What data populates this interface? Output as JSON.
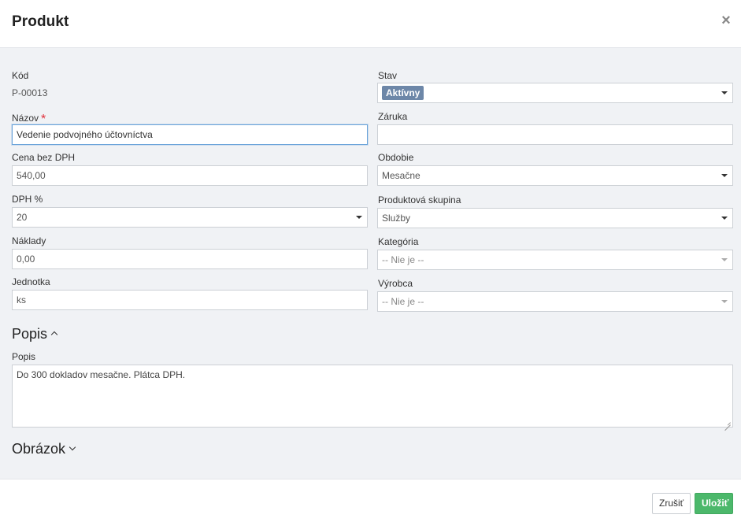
{
  "dialog": {
    "title": "Produkt",
    "close_symbol": "×"
  },
  "form": {
    "kod": {
      "label": "Kód",
      "value": "P-00013"
    },
    "nazov": {
      "label": "Názov",
      "required_mark": "*",
      "value": "Vedenie podvojného účtovníctva"
    },
    "cena": {
      "label": "Cena bez DPH",
      "value": "540,00"
    },
    "dph": {
      "label": "DPH %",
      "value": "20"
    },
    "naklady": {
      "label": "Náklady",
      "value": "0,00"
    },
    "jednotka": {
      "label": "Jednotka",
      "value": "ks"
    },
    "stav": {
      "label": "Stav",
      "value": "Aktívny"
    },
    "zaruka": {
      "label": "Záruka",
      "value": ""
    },
    "obdobie": {
      "label": "Obdobie",
      "value": "Mesačne"
    },
    "skupina": {
      "label": "Produktová skupina",
      "value": "Služby"
    },
    "kategoria": {
      "label": "Kategória",
      "value": "-- Nie je --"
    },
    "vyrobca": {
      "label": "Výrobca",
      "value": "-- Nie je --"
    }
  },
  "sections": {
    "popis": {
      "title": "Popis",
      "expanded": true,
      "field_label": "Popis",
      "value": "Do 300 dokladov mesačne. Plátca DPH."
    },
    "obrazok": {
      "title": "Obrázok",
      "expanded": false
    }
  },
  "footer": {
    "cancel_label": "Zrušiť",
    "save_label": "Uložiť"
  },
  "colors": {
    "status_badge": "#6d87a8",
    "save_button": "#4cb86b",
    "required": "#e0303a",
    "body_bg": "#f0f2f5"
  },
  "icons": {
    "close": "close-icon",
    "dropdown": "caret-down-icon",
    "section_expanded": "chevron-up-icon",
    "section_collapsed": "chevron-down-icon"
  }
}
